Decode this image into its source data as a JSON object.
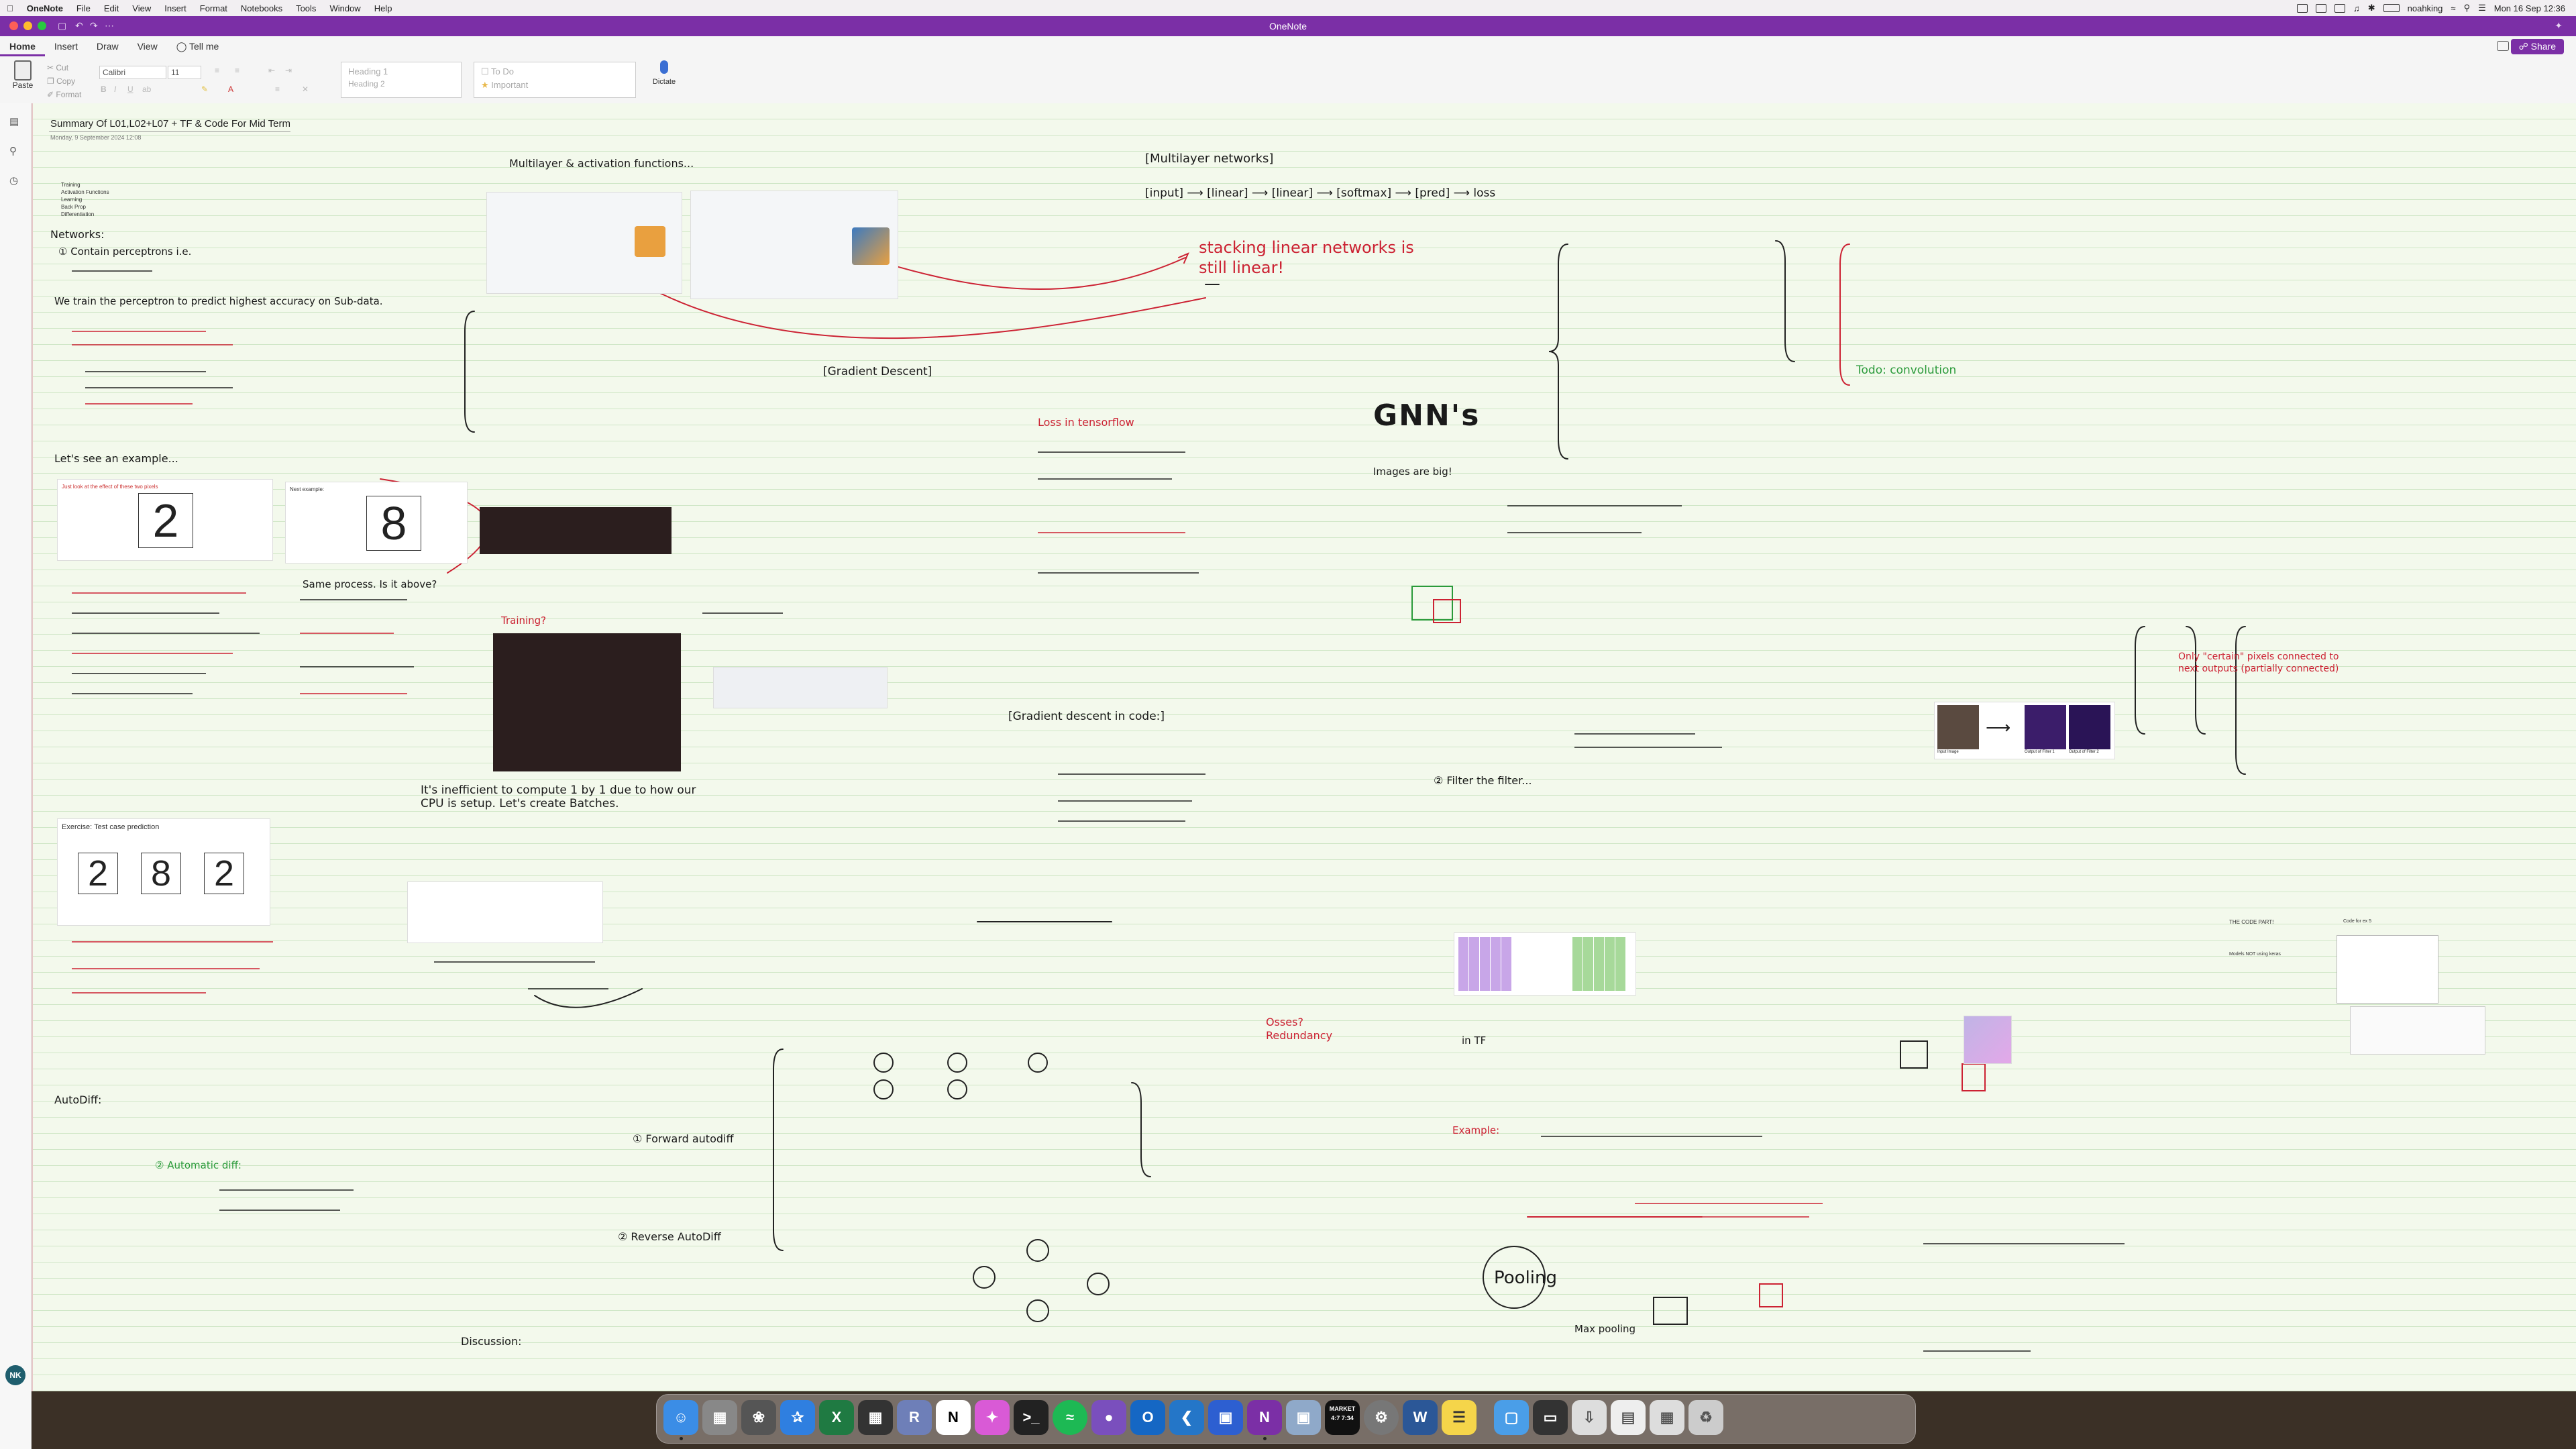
{
  "menubar": {
    "app_name": "OneNote",
    "menus": [
      "File",
      "Edit",
      "View",
      "Insert",
      "Format",
      "Notebooks",
      "Tools",
      "Window",
      "Help"
    ],
    "user": "noahking",
    "datetime": "Mon 16 Sep  12:36"
  },
  "window": {
    "title": "OneNote"
  },
  "ribbon": {
    "tabs": [
      "Home",
      "Insert",
      "Draw",
      "View"
    ],
    "tell_me": "Tell me",
    "share_label": "Share",
    "paste_label": "Paste",
    "cut_label": "Cut",
    "copy_label": "Copy",
    "format_label": "Format",
    "font_name": "Calibri",
    "font_size": "11",
    "style_heading1": "Heading 1",
    "style_heading2": "Heading 2",
    "tag_todo": "To Do",
    "tag_important": "Important",
    "dictate_label": "Dictate"
  },
  "page": {
    "title": "Summary Of L01,L02+L07 + TF & Code For Mid Term",
    "date": "Monday, 9 September 2024    12:08",
    "outline": [
      "Training",
      "Activation Functions",
      "Learning",
      "Back Prop",
      "Differentiation"
    ],
    "handwriting": {
      "networks": "Networks:",
      "contain": "① Contain perceptrons i.e.",
      "we_train": "We train the perceptron to predict highest accuracy on Sub-data.",
      "lets_see": "Let's see an example...",
      "same_process": "Same process. Is it above?",
      "training": "Training?",
      "mlp_title": "Multilayer & activation functions...",
      "mlp_net": "[Multilayer networks]",
      "mlp_flow": "[input] ⟶ [linear] ⟶ [linear] ⟶ [softmax] ⟶ [pred] ⟶ loss",
      "stacking": "stacking linear networks is still linear!",
      "gradient_descent": "[Gradient Descent]",
      "loss_in_tf": "Loss in tensorflow",
      "gd_in_code": "[Gradient descent in code:]",
      "inefficient": "It's inefficient to compute 1 by 1 due to how our CPU is setup. Let's create Batches.",
      "autodiff": "AutoDiff:",
      "automatic_diff": "② Automatic diff:",
      "forward_autodiff": "① Forward autodiff",
      "reverse_autodiff": "② Reverse AutoDiff",
      "discussion": "Discussion:",
      "gnns": "GNN's",
      "images_are_big": "Images are big!",
      "todo": "Todo: convolution",
      "filter": "② Filter the filter...",
      "pooling": "Pooling",
      "max_pooling": "Max pooling",
      "example": "Example:",
      "in_tf": "in TF",
      "only_certain": "Only \"certain\" pixels connected to next outputs (partially connected)",
      "osses_redundancy": "Osses? Redundancy"
    },
    "cards": {
      "ex1_caption": "Just look at the effect of these two pixels",
      "ex2_caption": "Next example:",
      "ex3_caption": "Exercise: Test case prediction",
      "digit1": "2",
      "digit2": "8",
      "test_digits": [
        "2",
        "8",
        "2"
      ],
      "conv_output_captions": [
        "Input Image",
        "Output of Filter 1",
        "Output of Filter 2"
      ]
    },
    "code_notes": {
      "heading": "THE CODE PART!",
      "models": "Models NOT using keras",
      "code_for_ex": "Code for ex 5"
    }
  },
  "user": {
    "initials": "NK"
  },
  "dock": {
    "apps": [
      "Finder",
      "Launchpad",
      "ChatGPT",
      "Safari",
      "Excel",
      "Grid",
      "Rider",
      "Notion",
      "Craft",
      "Terminal",
      "Spotify",
      "GitHub",
      "Outlook",
      "VS Code",
      "Bitwarden",
      "OneNote",
      "Preview",
      "Clock",
      "Settings",
      "Word",
      "Notes",
      "Files",
      "Screen",
      "Downloads",
      "Docs",
      "Window",
      "Trash"
    ],
    "clock_label": "MARKET 4:7 7:34"
  }
}
